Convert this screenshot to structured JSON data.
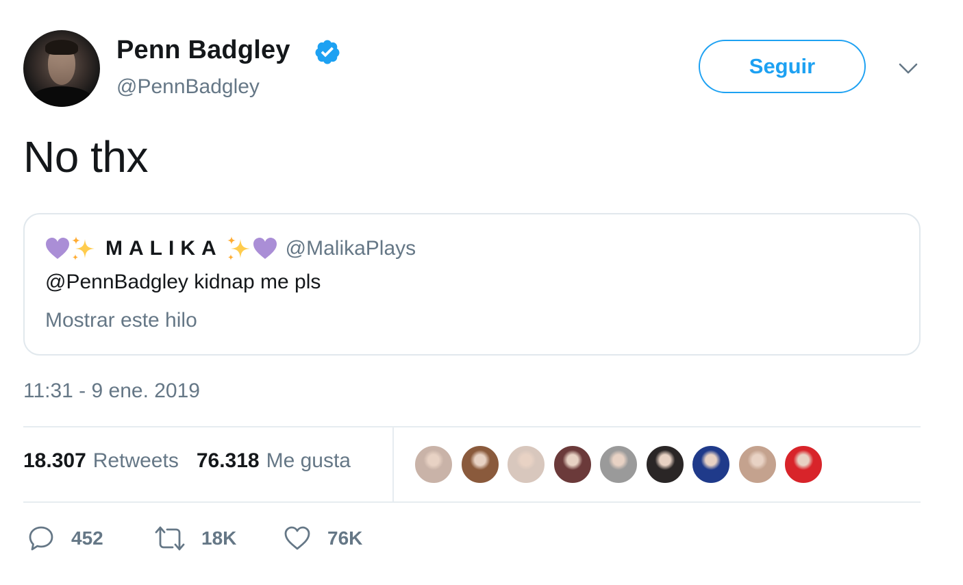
{
  "author": {
    "display_name": "Penn Badgley",
    "handle": "@PennBadgley",
    "verified_icon": "verified-badge-icon",
    "follow_label": "Seguir",
    "accent_color": "#1da1f2"
  },
  "tweet": {
    "text": "No thx",
    "timestamp": "11:31 - 9 ene. 2019"
  },
  "quote": {
    "name": "MALIKA",
    "name_prefix_icons": [
      "purple-heart-icon",
      "sparkles-icon"
    ],
    "name_suffix_icons": [
      "sparkles-icon",
      "purple-heart-icon"
    ],
    "handle": "@MalikaPlays",
    "text": "@PennBadgley kidnap me pls",
    "thread_link": "Mostrar este hilo"
  },
  "stats": {
    "retweets_count": "18.307",
    "retweets_label": "Retweets",
    "likes_count": "76.318",
    "likes_label": "Me gusta"
  },
  "likers": [
    {
      "name": "liker-1",
      "color": "#c9b3a8"
    },
    {
      "name": "liker-2",
      "color": "#8a5a3c"
    },
    {
      "name": "liker-3",
      "color": "#d8c7bd"
    },
    {
      "name": "liker-4",
      "color": "#6b3a3a"
    },
    {
      "name": "liker-5",
      "color": "#9a9a9a"
    },
    {
      "name": "liker-6",
      "color": "#2a2626"
    },
    {
      "name": "liker-7",
      "color": "#1f3a8a"
    },
    {
      "name": "liker-8",
      "color": "#c4a28e"
    },
    {
      "name": "liker-9",
      "color": "#d8242a"
    }
  ],
  "actions": {
    "replies": "452",
    "retweets": "18K",
    "likes": "76K"
  }
}
